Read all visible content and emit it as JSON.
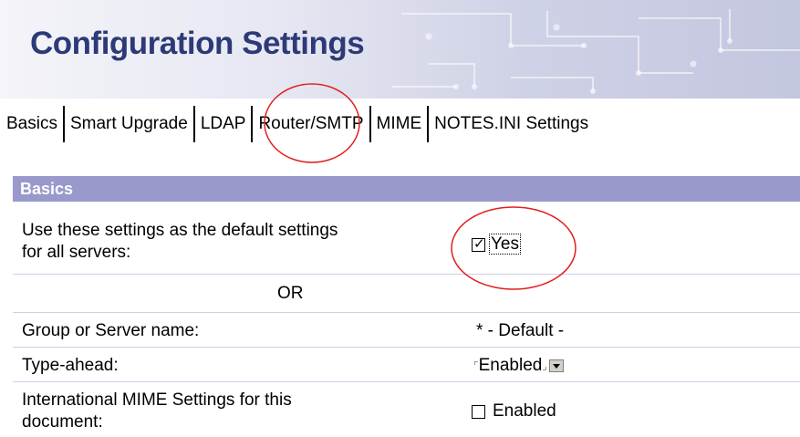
{
  "banner": {
    "title": "Configuration Settings"
  },
  "tabs": [
    {
      "label": "Basics"
    },
    {
      "label": "Smart Upgrade"
    },
    {
      "label": "LDAP"
    },
    {
      "label": "Router/SMTP"
    },
    {
      "label": "MIME"
    },
    {
      "label": "NOTES.INI Settings"
    }
  ],
  "section": {
    "title": "Basics"
  },
  "rows": {
    "default_settings": {
      "label_line1": "Use these settings as the default settings",
      "label_line2": "for all servers:",
      "checkbox_label": "Yes",
      "checked": true
    },
    "or_text": "OR",
    "group_server": {
      "label": "Group or Server name:",
      "value": "* - Default -"
    },
    "type_ahead": {
      "label": "Type-ahead:",
      "value": "Enabled"
    },
    "intl_mime": {
      "label_line1": "International MIME Settings for this",
      "label_line2": "document:",
      "checkbox_label": "Enabled",
      "checked": false
    }
  },
  "colors": {
    "title": "#2d3a78",
    "section_header": "#9999cc",
    "annotation_circle": "#e02020"
  }
}
